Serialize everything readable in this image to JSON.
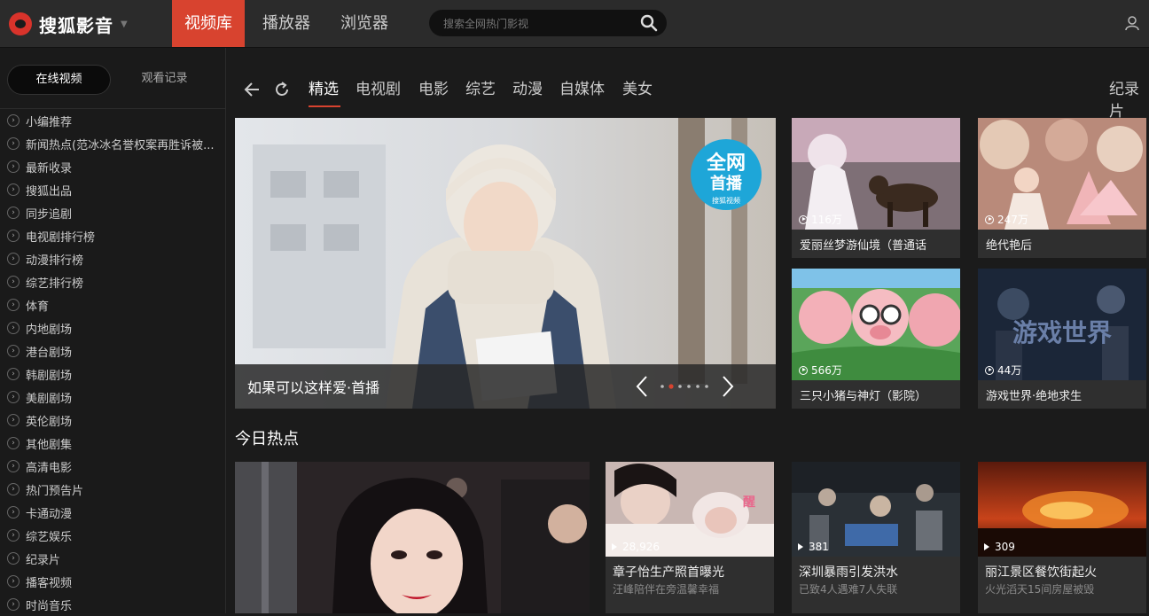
{
  "app": {
    "brand": "搜狐影音"
  },
  "top_tabs": [
    {
      "label": "视频库",
      "active": true
    },
    {
      "label": "播放器",
      "active": false
    },
    {
      "label": "浏览器",
      "active": false
    }
  ],
  "search": {
    "placeholder": "搜索全网热门影视"
  },
  "sidebar": {
    "tabs": [
      {
        "label": "在线视频",
        "active": true
      },
      {
        "label": "观看记录",
        "active": false
      }
    ],
    "items": [
      "小编推荐",
      "新闻热点(范冰冰名誉权案再胜诉被...",
      "最新收录",
      "搜狐出品",
      "同步追剧",
      "电视剧排行榜",
      "动漫排行榜",
      "综艺排行榜",
      "体育",
      "内地剧场",
      "港台剧场",
      "韩剧剧场",
      "美剧剧场",
      "英伦剧场",
      "其他剧集",
      "高清电影",
      "热门预告片",
      "卡通动漫",
      "综艺娱乐",
      "纪录片",
      "播客视频",
      "时尚音乐"
    ]
  },
  "categories": [
    "精选",
    "电视剧",
    "电影",
    "综艺",
    "动漫",
    "自媒体",
    "美女"
  ],
  "categories_right": "纪录片",
  "hero": {
    "title": "如果可以这样爱·首播",
    "badge_line1": "全网",
    "badge_line2": "首播",
    "badge_small": "搜狐视频",
    "slide_count": 6,
    "active_slide": 2
  },
  "featured": [
    {
      "title": "爱丽丝梦游仙境（普通话",
      "plays": "116万"
    },
    {
      "title": "绝代艳后",
      "plays": "247万"
    },
    {
      "title": "三只小猪与神灯（影院）",
      "plays": "566万"
    },
    {
      "title": "游戏世界·绝地求生",
      "plays": "44万"
    }
  ],
  "hot_today": {
    "title": "今日热点",
    "items": [
      {
        "title": "章子怡生产照首曝光",
        "subtitle": "汪峰陪伴在旁温馨幸福",
        "plays": "28,926"
      },
      {
        "title": "深圳暴雨引发洪水",
        "subtitle": "已致4人遇难7人失联",
        "plays": "381"
      },
      {
        "title": "丽江景区餐饮街起火",
        "subtitle": "火光滔天15间房屋被毁",
        "plays": "309"
      }
    ]
  },
  "colors": {
    "accent": "#d8432f",
    "topbar": "#2b2b2b",
    "background": "#1b1b1b"
  }
}
